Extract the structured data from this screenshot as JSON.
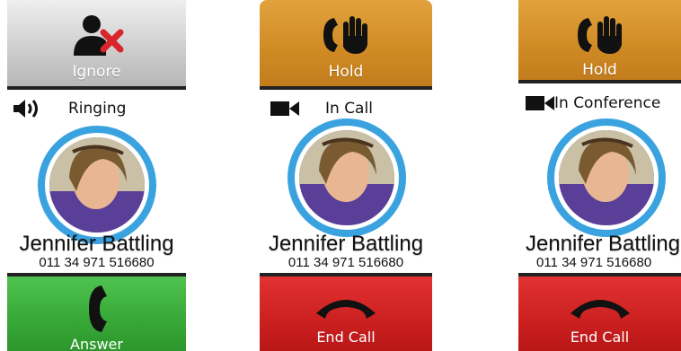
{
  "screens": [
    {
      "top_button": {
        "label": "Ignore",
        "icon": "ignore-user-icon"
      },
      "status": {
        "icon": "speaker-icon",
        "text": "Ringing"
      },
      "contact": {
        "name": "Jennifer Battling",
        "number": "011 34 971 516680"
      },
      "bottom_button": {
        "label": "Answer",
        "icon": "phone-answer-icon"
      }
    },
    {
      "top_button": {
        "label": "Hold",
        "icon": "hold-hand-icon"
      },
      "status": {
        "icon": "video-camera-icon",
        "text": "In Call"
      },
      "contact": {
        "name": "Jennifer Battling",
        "number": "011 34 971 516680"
      },
      "bottom_button": {
        "label": "End Call",
        "icon": "phone-hangup-icon"
      }
    },
    {
      "top_button": {
        "label": "Hold",
        "icon": "hold-hand-icon"
      },
      "status": {
        "icon": "video-camera-icon",
        "text": "In Conference"
      },
      "contact": {
        "name": "Jennifer Battling",
        "number": "011 34 971 516680"
      },
      "bottom_button": {
        "label": "End Call",
        "icon": "phone-hangup-icon"
      }
    }
  ],
  "colors": {
    "ignore_gray": "#c8c8c8",
    "hold_orange": "#d08a24",
    "answer_green": "#37a837",
    "end_red": "#cc2020",
    "avatar_ring_blue": "#3aa3df"
  }
}
